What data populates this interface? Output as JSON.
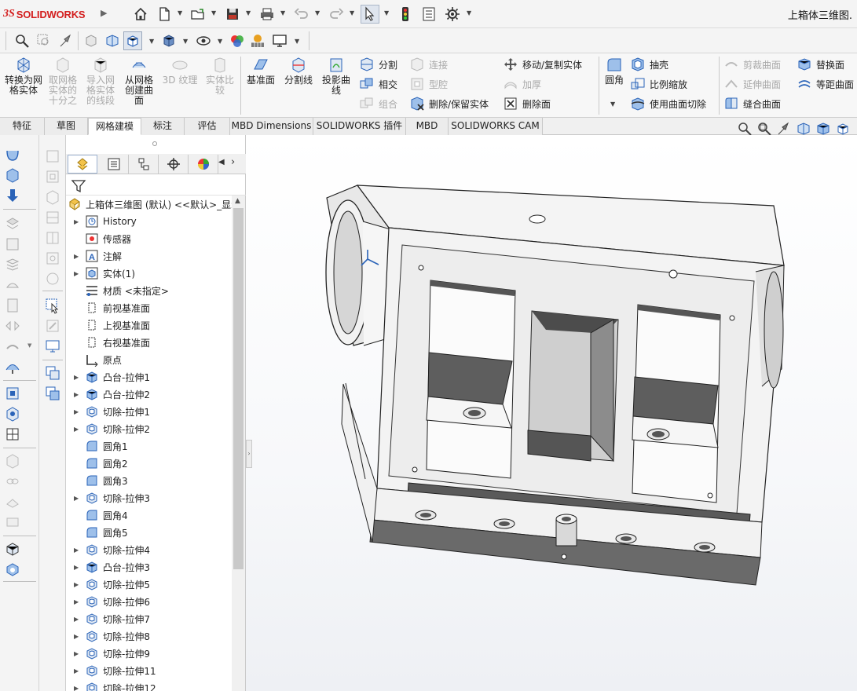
{
  "app": {
    "logo_prefix": "3S",
    "logo_text": "SOLIDWORKS",
    "doc_title": "上箱体三维图."
  },
  "quick_access": {
    "icons": [
      "home-icon",
      "new-document-icon",
      "open-icon",
      "save-icon",
      "print-icon",
      "undo-icon",
      "redo-icon",
      "select-icon",
      "traffic-light-icon",
      "file-properties-icon",
      "options-gear-icon"
    ]
  },
  "ribbon": {
    "convert_to_mesh": "转换为网格实体",
    "take_tenth": "取网格实体的十分之",
    "import_mesh_segments": "导入网格实体的线段",
    "create_from_mesh": "从网格创建曲面",
    "texture_3d": "3D 纹理",
    "solid_compare": "实体比较",
    "ref_plane": "基准面",
    "split_line": "分割线",
    "projected_curve": "投影曲线",
    "split": "分割",
    "intersect": "相交",
    "combine": "组合",
    "connect": "连接",
    "cavity": "型腔",
    "delete_keep_body": "删除/保留实体",
    "move_copy_body": "移动/复制实体",
    "thicken": "加厚",
    "delete_face": "删除面",
    "fillet": "圆角",
    "shell": "抽壳",
    "scale": "比例缩放",
    "cut_with_surface": "使用曲面切除",
    "trim_surface": "剪裁曲面",
    "extend_surface": "延伸曲面",
    "knit_surface": "缝合曲面",
    "replace_face": "替换面",
    "offset_surface": "等距曲面"
  },
  "tabs": [
    "特征",
    "草图",
    "网格建模",
    "标注",
    "评估",
    "MBD Dimensions",
    "SOLIDWORKS 插件",
    "MBD",
    "SOLIDWORKS CAM"
  ],
  "active_tab": "网格建模",
  "tree": {
    "root": "上箱体三维图 (默认) <<默认>_显示",
    "items": [
      {
        "label": "History",
        "icon": "history-icon",
        "expand": true
      },
      {
        "label": "传感器",
        "icon": "sensor-icon",
        "expand": false
      },
      {
        "label": "注解",
        "icon": "annotation-icon",
        "expand": true
      },
      {
        "label": "实体(1)",
        "icon": "solid-bodies-icon",
        "expand": true
      },
      {
        "label": "材质 <未指定>",
        "icon": "material-icon",
        "expand": false
      },
      {
        "label": "前视基准面",
        "icon": "plane-icon",
        "expand": false
      },
      {
        "label": "上视基准面",
        "icon": "plane-icon",
        "expand": false
      },
      {
        "label": "右视基准面",
        "icon": "plane-icon",
        "expand": false
      },
      {
        "label": "原点",
        "icon": "origin-icon",
        "expand": false
      },
      {
        "label": "凸台-拉伸1",
        "icon": "boss-extrude-icon",
        "expand": true
      },
      {
        "label": "凸台-拉伸2",
        "icon": "boss-extrude-icon",
        "expand": true
      },
      {
        "label": "切除-拉伸1",
        "icon": "cut-extrude-icon",
        "expand": true
      },
      {
        "label": "切除-拉伸2",
        "icon": "cut-extrude-icon",
        "expand": true
      },
      {
        "label": "圆角1",
        "icon": "fillet-icon",
        "expand": false
      },
      {
        "label": "圆角2",
        "icon": "fillet-icon",
        "expand": false
      },
      {
        "label": "圆角3",
        "icon": "fillet-icon",
        "expand": false
      },
      {
        "label": "切除-拉伸3",
        "icon": "cut-extrude-icon",
        "expand": true
      },
      {
        "label": "圆角4",
        "icon": "fillet-icon",
        "expand": false
      },
      {
        "label": "圆角5",
        "icon": "fillet-icon",
        "expand": false
      },
      {
        "label": "切除-拉伸4",
        "icon": "cut-extrude-icon",
        "expand": true
      },
      {
        "label": "凸台-拉伸3",
        "icon": "boss-extrude-icon",
        "expand": true
      },
      {
        "label": "切除-拉伸5",
        "icon": "cut-extrude-icon",
        "expand": true
      },
      {
        "label": "切除-拉伸6",
        "icon": "cut-extrude-icon",
        "expand": true
      },
      {
        "label": "切除-拉伸7",
        "icon": "cut-extrude-icon",
        "expand": true
      },
      {
        "label": "切除-拉伸8",
        "icon": "cut-extrude-icon",
        "expand": true
      },
      {
        "label": "切除-拉伸9",
        "icon": "cut-extrude-icon",
        "expand": true
      },
      {
        "label": "切除-拉伸11",
        "icon": "cut-extrude-icon",
        "expand": true
      },
      {
        "label": "切除-拉伸12",
        "icon": "cut-extrude-icon",
        "expand": true
      }
    ]
  },
  "colors": {
    "accent": "#2a63b8",
    "logo_red": "#d31e1e",
    "model_face": "#f2f2f2",
    "model_shadow": "#707070"
  }
}
